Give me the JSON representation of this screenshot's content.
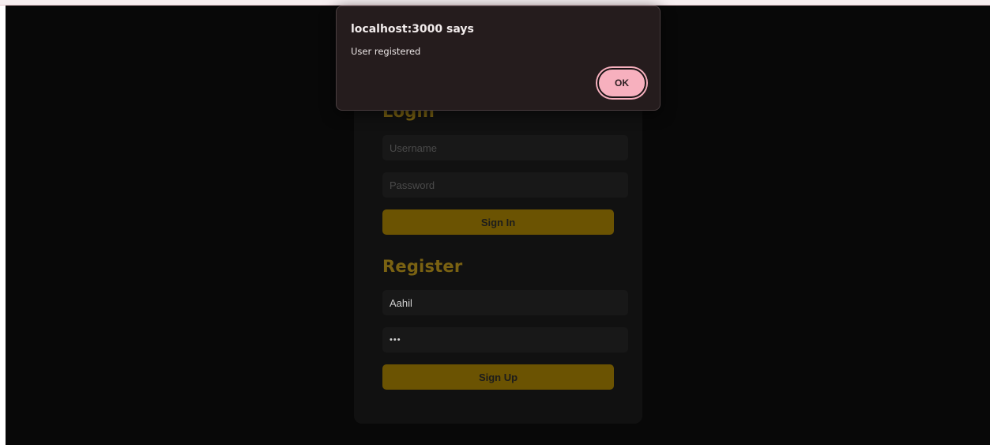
{
  "dialog": {
    "title": "localhost:3000 says",
    "message": "User registered",
    "ok_label": "OK"
  },
  "login": {
    "heading": "Login",
    "username_placeholder": "Username",
    "password_placeholder": "Password",
    "submit_label": "Sign In"
  },
  "register": {
    "heading": "Register",
    "username_value": "Aahil",
    "password_value": "•••",
    "submit_label": "Sign Up"
  },
  "colors": {
    "background": "#080808",
    "card": "#111111",
    "accent_gold": "#6b5302",
    "heading_gold": "#7a6212",
    "dialog_bg": "#251c1d",
    "ok_pink": "#f7b0be"
  }
}
